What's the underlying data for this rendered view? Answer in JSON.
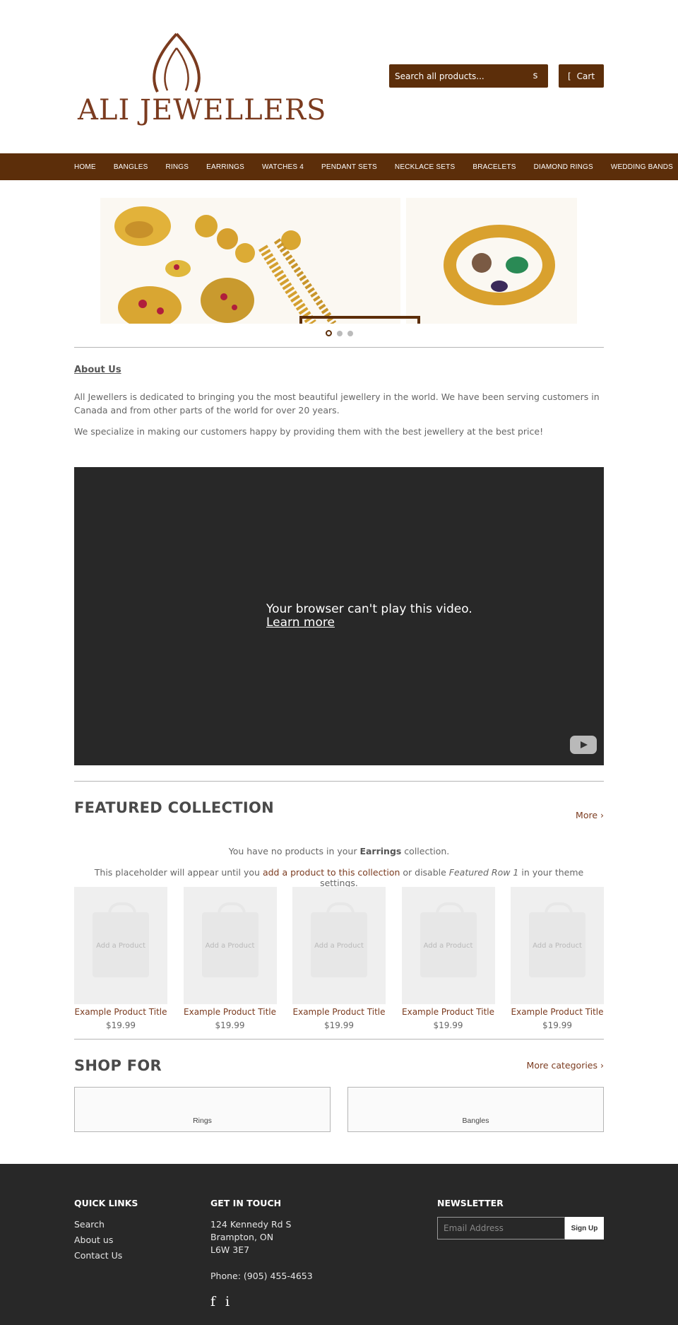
{
  "header": {
    "logo_text": "ALI JEWELLERS",
    "search_placeholder": "Search all products...",
    "search_button": "s",
    "cart_icon": "[",
    "cart_label": "Cart",
    "colors": {
      "brand": "#5c2e0a",
      "accent": "#7b3b1f"
    }
  },
  "nav": {
    "items": [
      "HOME",
      "BANGLES",
      "RINGS",
      "EARRINGS",
      "WATCHES 4",
      "PENDANT SETS",
      "NECKLACE SETS",
      "BRACELETS",
      "DIAMOND RINGS",
      "WEDDING BANDS"
    ]
  },
  "slideshow": {
    "slide_count": 3,
    "active_slide": 1
  },
  "about": {
    "title": "About Us",
    "p1": "All Jewellers is dedicated to bringing you the most beautiful jewellery in the world. We have been serving customers in Canada and from other parts of the world for over 20 years.",
    "p2": "We specialize in making our customers happy by providing them with the best jewellery at the best price!"
  },
  "video": {
    "message": "Your browser can't play this video.",
    "link": "Learn more"
  },
  "featured": {
    "title": "FEATURED COLLECTION",
    "more": "More ›",
    "empty_pre": "You have no products in your ",
    "empty_collection": "Earrings",
    "empty_post": " collection.",
    "placeholder_pre": "This placeholder will appear until you ",
    "placeholder_link": "add a product to this collection",
    "placeholder_mid": " or disable ",
    "placeholder_em": "Featured Row 1",
    "placeholder_post": " in your theme settings.",
    "products": [
      {
        "img_label": "Add a Product",
        "title": "Example Product Title",
        "price": "$19.99"
      },
      {
        "img_label": "Add a Product",
        "title": "Example Product Title",
        "price": "$19.99"
      },
      {
        "img_label": "Add a Product",
        "title": "Example Product Title",
        "price": "$19.99"
      },
      {
        "img_label": "Add a Product",
        "title": "Example Product Title",
        "price": "$19.99"
      },
      {
        "img_label": "Add a Product",
        "title": "Example Product Title",
        "price": "$19.99"
      }
    ]
  },
  "shop_for": {
    "title": "SHOP FOR",
    "more": "More categories ›",
    "categories": [
      "Rings",
      "Bangles"
    ]
  },
  "footer": {
    "quick_links_title": "QUICK LINKS",
    "quick_links": [
      "Search",
      "About us",
      "Contact Us"
    ],
    "contact_title": "GET IN TOUCH",
    "address": [
      "124 Kennedy Rd S",
      "Brampton, ON",
      "L6W 3E7"
    ],
    "phone": "Phone: (905) 455-4653",
    "social": [
      "f",
      "i"
    ],
    "newsletter_title": "NEWSLETTER",
    "email_placeholder": "Email Address",
    "signup": "Sign Up"
  }
}
